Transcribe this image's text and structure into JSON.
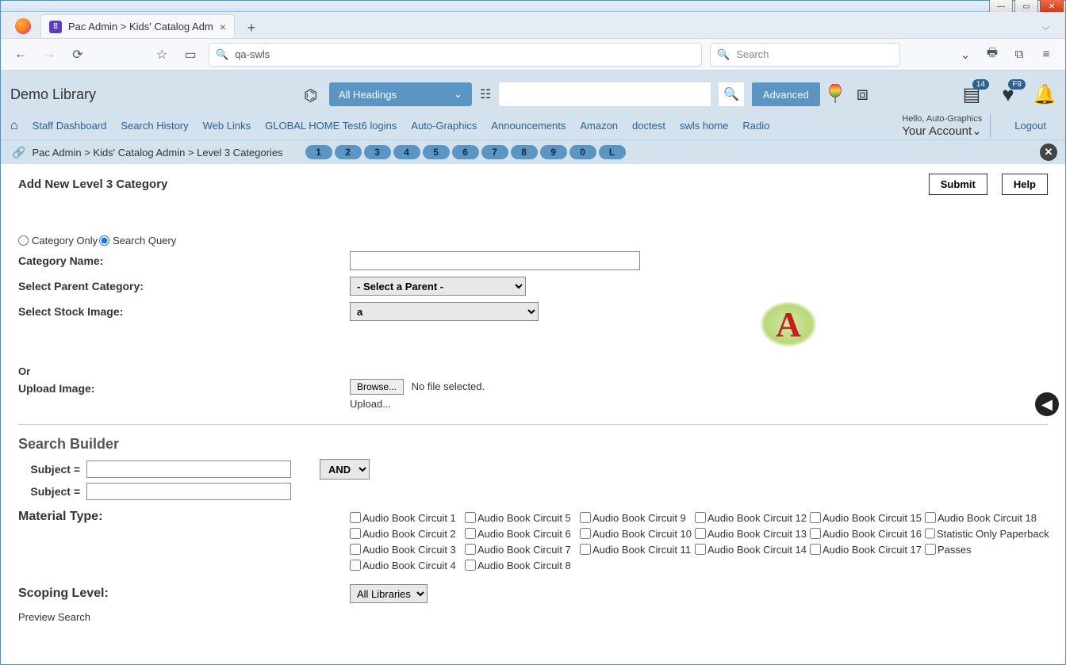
{
  "browser": {
    "tab_title": "Pac Admin > Kids' Catalog Adm",
    "url_text": "qa-swls",
    "search_placeholder": "Search"
  },
  "header": {
    "app_title": "Demo Library",
    "headings_dd": "All Headings",
    "advanced": "Advanced",
    "badge_list": "14",
    "badge_fav": "F9",
    "hello": "Hello, Auto-Graphics",
    "your_account": "Your Account",
    "logout": "Logout"
  },
  "nav": {
    "items": [
      "Staff Dashboard",
      "Search History",
      "Web Links",
      "GLOBAL HOME Test6 logins",
      "Auto-Graphics",
      "Announcements",
      "Amazon",
      "doctest",
      "swls home",
      "Radio"
    ]
  },
  "breadcrumb": {
    "text": "Pac Admin  >  Kids' Catalog Admin  >  Level 3 Categories",
    "pills": [
      "1",
      "2",
      "3",
      "4",
      "5",
      "6",
      "7",
      "8",
      "9",
      "0",
      "L"
    ]
  },
  "page": {
    "title": "Add New Level 3 Category",
    "submit": "Submit",
    "help": "Help",
    "radio_category_only": "Category Only",
    "radio_search_query": "Search Query",
    "label_category_name": "Category Name:",
    "label_parent": "Select Parent Category:",
    "parent_value": "- Select a Parent -",
    "label_stock": "Select Stock Image:",
    "stock_value": "a",
    "or": "Or",
    "label_upload": "Upload Image:",
    "browse": "Browse...",
    "no_file": "No file selected.",
    "upload_link": "Upload...",
    "sb_title": "Search Builder",
    "subject_eq": "Subject =",
    "and": "AND",
    "mt_label": "Material Type:",
    "mt_items": [
      "Audio Book Circuit 1",
      "Audio Book Circuit 5",
      "Audio Book Circuit 9",
      "Audio Book Circuit 12",
      "Audio Book Circuit 15",
      "Audio Book Circuit 18",
      "Audio Book Circuit 2",
      "Audio Book Circuit 6",
      "Audio Book Circuit 10",
      "Audio Book Circuit 13",
      "Audio Book Circuit 16",
      "Statistic Only Paperback",
      "Audio Book Circuit 3",
      "Audio Book Circuit 7",
      "Audio Book Circuit 11",
      "Audio Book Circuit 14",
      "Audio Book Circuit 17",
      "Passes",
      "Audio Book Circuit 4",
      "Audio Book Circuit 8",
      "",
      "",
      "",
      ""
    ],
    "scope_label": "Scoping Level:",
    "scope_value": "All Libraries",
    "preview": "Preview Search"
  }
}
